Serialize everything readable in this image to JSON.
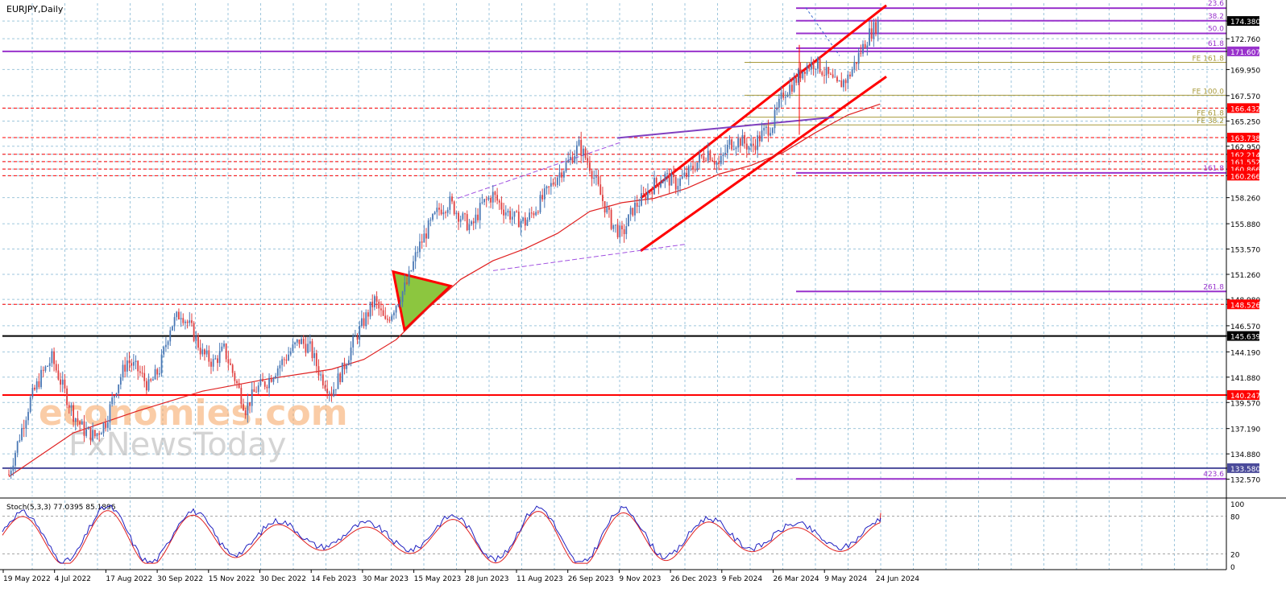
{
  "chart_data": {
    "type": "line",
    "title": "EURJPY,Daily",
    "symbol": "EURJPY",
    "timeframe": "Daily",
    "price_axis": {
      "ylim": [
        131.0,
        176.0
      ],
      "tick_labels": [
        "174.380",
        "172.760",
        "171.607",
        "169.950",
        "167.570",
        "166.432",
        "165.250",
        "163.738",
        "162.950",
        "162.214",
        "161.552",
        "160.866",
        "160.266",
        "158.260",
        "155.880",
        "153.570",
        "151.260",
        "148.980",
        "148.526",
        "146.570",
        "145.639",
        "144.190",
        "141.880",
        "140.247",
        "139.570",
        "137.190",
        "134.880",
        "133.580",
        "132.570"
      ]
    },
    "time_axis": {
      "labels": [
        "19 May 2022",
        "4 Jul 2022",
        "17 Aug 2022",
        "30 Sep 2022",
        "15 Nov 2022",
        "30 Dec 2022",
        "14 Feb 2023",
        "30 Mar 2023",
        "15 May 2023",
        "28 Jun 2023",
        "11 Aug 2023",
        "26 Sep 2023",
        "9 Nov 2023",
        "26 Dec 2023",
        "9 Feb 2024",
        "26 Mar 2024",
        "9 May 2024",
        "24 Jun 2024"
      ]
    },
    "series": [
      {
        "name": "",
        "values_approx": [
          [
            0,
            133.0
          ],
          [
            1,
            136.5
          ],
          [
            2,
            139.8
          ],
          [
            3,
            142.0
          ],
          [
            4,
            143.6
          ],
          [
            5,
            141.0
          ],
          [
            6,
            138.5
          ],
          [
            7,
            137.0
          ],
          [
            8,
            136.5
          ],
          [
            9,
            137.8
          ],
          [
            10,
            141.0
          ],
          [
            11,
            143.4
          ],
          [
            12,
            142.5
          ],
          [
            13,
            141.0
          ],
          [
            14,
            142.6
          ],
          [
            15,
            146.5
          ],
          [
            16,
            147.8
          ],
          [
            17,
            146.2
          ],
          [
            18,
            144.0
          ],
          [
            19,
            143.2
          ],
          [
            20,
            144.4
          ],
          [
            21,
            141.8
          ],
          [
            22,
            139.0
          ],
          [
            23,
            140.8
          ],
          [
            24,
            141.5
          ],
          [
            25,
            142.8
          ],
          [
            26,
            144.0
          ],
          [
            27,
            145.2
          ],
          [
            28,
            144.5
          ],
          [
            29,
            142.0
          ],
          [
            30,
            140.5
          ],
          [
            31,
            142.5
          ],
          [
            32,
            145.0
          ],
          [
            33,
            147.0
          ],
          [
            34,
            148.9
          ],
          [
            35,
            146.8
          ],
          [
            36,
            148.6
          ],
          [
            37,
            150.4
          ],
          [
            38,
            153.5
          ],
          [
            39,
            155.5
          ],
          [
            40,
            157.2
          ],
          [
            41,
            157.8
          ],
          [
            42,
            156.5
          ],
          [
            43,
            155.5
          ],
          [
            44,
            157.6
          ],
          [
            45,
            158.5
          ],
          [
            46,
            157.2
          ],
          [
            47,
            156.4
          ],
          [
            48,
            156.0
          ],
          [
            49,
            157.3
          ],
          [
            50,
            158.7
          ],
          [
            51,
            160.3
          ],
          [
            52,
            161.5
          ],
          [
            53,
            163.0
          ],
          [
            54,
            161.2
          ],
          [
            55,
            158.5
          ],
          [
            56,
            156.0
          ],
          [
            57,
            154.8
          ],
          [
            58,
            157.2
          ],
          [
            59,
            158.3
          ],
          [
            60,
            159.5
          ],
          [
            61,
            160.2
          ],
          [
            62,
            159.5
          ],
          [
            63,
            160.3
          ],
          [
            64,
            161.5
          ],
          [
            65,
            162.5
          ],
          [
            66,
            161.2
          ],
          [
            67,
            163.2
          ],
          [
            68,
            163.5
          ],
          [
            69,
            162.8
          ],
          [
            70,
            164.0
          ],
          [
            71,
            165.0
          ],
          [
            72,
            167.8
          ],
          [
            73,
            168.8
          ],
          [
            74,
            170.2
          ],
          [
            75,
            170.6
          ],
          [
            76,
            169.5
          ],
          [
            77,
            168.4
          ],
          [
            78,
            169.2
          ],
          [
            79,
            171.2
          ],
          [
            80,
            173.2
          ],
          [
            81,
            174.4
          ]
        ]
      },
      {
        "name": "",
        "values_approx": [
          [
            0,
            132.8
          ],
          [
            6,
            136.8
          ],
          [
            12,
            138.8
          ],
          [
            18,
            140.6
          ],
          [
            24,
            141.7
          ],
          [
            30,
            142.6
          ],
          [
            33,
            143.5
          ],
          [
            36,
            145.3
          ],
          [
            39,
            148.2
          ],
          [
            42,
            150.8
          ],
          [
            45,
            152.5
          ],
          [
            48,
            153.6
          ],
          [
            51,
            155.0
          ],
          [
            54,
            157.0
          ],
          [
            57,
            157.8
          ],
          [
            60,
            158.2
          ],
          [
            63,
            159.1
          ],
          [
            66,
            160.4
          ],
          [
            69,
            161.2
          ],
          [
            72,
            162.4
          ],
          [
            75,
            164.2
          ],
          [
            78,
            165.8
          ],
          [
            81,
            166.8
          ]
        ]
      }
    ],
    "horizontal_levels": [
      {
        "value": 171.607,
        "label": "171.607",
        "style": "solid",
        "color": "#9932cc"
      },
      {
        "value": 166.432,
        "label": "166.432",
        "style": "dashed",
        "color": "#ff0000"
      },
      {
        "value": 163.738,
        "label": "163.738",
        "style": "dashed",
        "color": "#ff0000"
      },
      {
        "value": 162.214,
        "label": "162.214",
        "style": "dashed",
        "color": "#ff0000"
      },
      {
        "value": 161.552,
        "label": "161.552",
        "style": "dashed",
        "color": "#ff0000"
      },
      {
        "value": 160.866,
        "label": "160.866",
        "style": "dashed",
        "color": "#ff0000"
      },
      {
        "value": 160.266,
        "label": "160.266",
        "style": "dashed",
        "color": "#ff0000"
      },
      {
        "value": 148.526,
        "label": "148.526",
        "style": "dashed",
        "color": "#ff0000"
      },
      {
        "value": 145.639,
        "label": "145.639",
        "style": "solid",
        "color": "#000000"
      },
      {
        "value": 140.247,
        "label": "140.247",
        "style": "solid",
        "color": "#ff0000"
      },
      {
        "value": 133.58,
        "label": "133.580",
        "style": "solid",
        "color": "#4a4a9a"
      }
    ],
    "current_price": {
      "value": 174.38,
      "label": "174.380"
    },
    "fibonacci_levels": [
      {
        "value": 175.55,
        "label": "23.6"
      },
      {
        "value": 174.4,
        "label": "38.2"
      },
      {
        "value": 173.25,
        "label": "50.0"
      },
      {
        "value": 171.9,
        "label": "61.8"
      },
      {
        "value": 160.52,
        "label": "161.8"
      },
      {
        "value": 149.7,
        "label": "261.8"
      },
      {
        "value": 132.6,
        "label": "423.6"
      }
    ],
    "fibonacci_expansion": [
      {
        "value": 170.6,
        "label": "FE 161.8"
      },
      {
        "value": 167.6,
        "label": "FE 100.0"
      },
      {
        "value": 165.6,
        "label": "FE 61.8"
      },
      {
        "value": 164.9,
        "label": "FE 38.2"
      }
    ],
    "oscillator": {
      "label": "Stoch(5,3,3) 77.0395 85.1896",
      "name": "Stoch(5,3,3)",
      "values": [
        77.0395,
        85.1896
      ],
      "range": [
        0,
        100
      ],
      "tick_labels": [
        "100",
        "80",
        "20",
        "0"
      ]
    },
    "watermarks": [
      "economies.com",
      "FxNewsToday"
    ],
    "grid": true
  },
  "colors": {
    "background": "#ffffff",
    "grid": "#9ec6dc",
    "bull_candle": "#4a78b5",
    "bear_candle": "#e04040",
    "moving_average": "#e02020",
    "fib": "#9932cc",
    "fib_expansion": "#a89a3c",
    "channel": "#ff0000",
    "triangle_fill": "#8cc63f",
    "stoch_main": "#2020c0",
    "stoch_signal": "#e02020",
    "level_label_red": "#ff0000",
    "level_label_black": "#000000",
    "level_label_purple": "#9932cc",
    "level_label_navy": "#4a4a9a"
  }
}
